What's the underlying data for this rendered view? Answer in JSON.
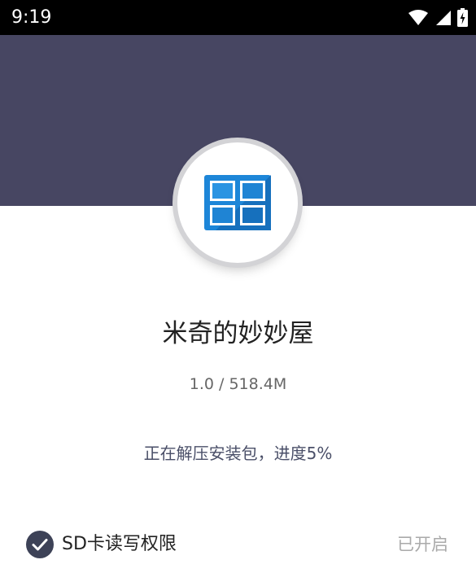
{
  "status_bar": {
    "time": "9:19"
  },
  "app": {
    "name": "米奇的妙妙屋",
    "size_text": "1.0 / 518.4M",
    "icon": "windows-logo-icon"
  },
  "install": {
    "progress_text": "正在解压安装包，进度5%",
    "progress_percent": 5
  },
  "permission": {
    "label": "SD卡读写权限",
    "status": "已开启",
    "granted": true
  },
  "colors": {
    "header": "#474662",
    "icon_blue": "#1f7fd0",
    "check": "#3d4257"
  }
}
